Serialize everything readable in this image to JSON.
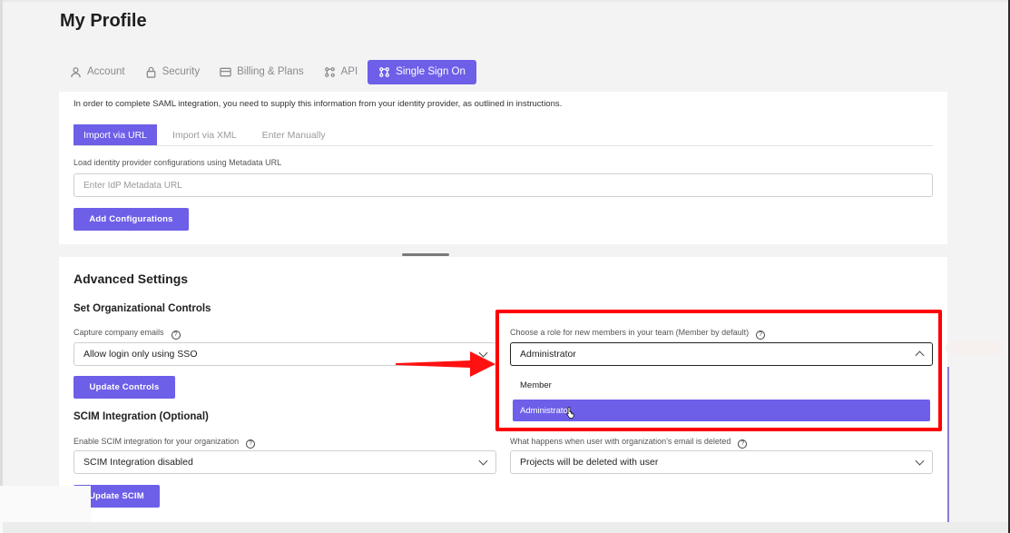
{
  "page": {
    "title": "My Profile"
  },
  "tabs": [
    {
      "label": "Account",
      "icon": "user-icon"
    },
    {
      "label": "Security",
      "icon": "lock-icon"
    },
    {
      "label": "Billing & Plans",
      "icon": "card-icon"
    },
    {
      "label": "API",
      "icon": "api-icon"
    },
    {
      "label": "Single Sign On",
      "icon": "sso-icon",
      "active": true
    }
  ],
  "saml": {
    "intro": "In order to complete SAML integration, you need to supply this information from your identity provider, as outlined in instructions.",
    "subtabs": [
      "Import via URL",
      "Import via XML",
      "Enter Manually"
    ],
    "url_label": "Load identity provider configurations using Metadata URL",
    "url_placeholder": "Enter IdP Metadata URL",
    "add_button": "Add Configurations"
  },
  "advanced": {
    "title": "Advanced Settings",
    "org_controls_title": "Set Organizational Controls",
    "capture_label": "Capture company emails",
    "capture_value": "Allow login only using SSO",
    "role_label": "Choose a role for new members in your team (Member by default)",
    "role_value": "Administrator",
    "role_options": [
      "Member",
      "Administrator"
    ],
    "update_controls": "Update Controls",
    "scim_title": "SCIM Integration (Optional)",
    "scim_label": "Enable SCIM integration for your organization",
    "scim_value": "SCIM Integration disabled",
    "deleted_label": "What happens when user with organization's email is deleted",
    "deleted_value": "Projects will be deleted with user",
    "update_scim": "Update SCIM"
  },
  "colors": {
    "accent": "#6d5fe8",
    "highlight": "#ff0000"
  }
}
